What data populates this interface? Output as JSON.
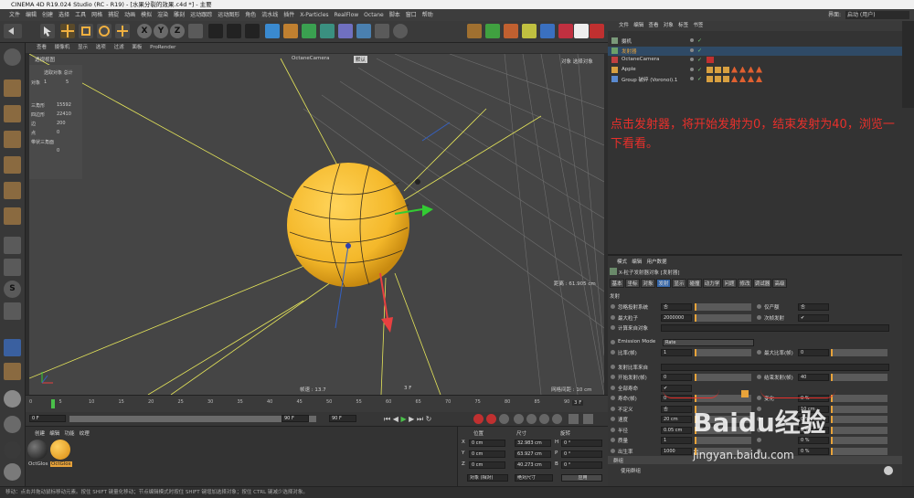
{
  "title": "CINEMA 4D R19.024 Studio (RC - R19) - [水果分裂的效果.c4d *] - 主要",
  "menu": [
    "文件",
    "编辑",
    "创建",
    "选择",
    "工具",
    "网格",
    "捕捉",
    "动画",
    "模拟",
    "渲染",
    "雕刻",
    "运动跟踪",
    "运动图形",
    "角色",
    "流水线",
    "插件",
    "X-Particles",
    "RealFlow",
    "Octane",
    "脚本",
    "窗口",
    "帮助"
  ],
  "layout_label": "界面:",
  "layout_value": "启动 (用户)",
  "viewport": {
    "menu": [
      "查看",
      "摄像机",
      "显示",
      "选项",
      "过滤",
      "面板",
      "ProRender"
    ],
    "title": "透视视图",
    "camera": "OctaneCamera",
    "camera_tag": "默认",
    "top_right": "对象 选择对象",
    "stats": {
      "header": "选取对象 总计",
      "obj_label": "对象",
      "obj_sel": "1",
      "obj_total": "5",
      "tri_label": "三角形",
      "tri": "15592",
      "poly_label": "四边形",
      "poly": "22410",
      "edge_label": "边",
      "edge": "200",
      "pt_label": "点",
      "pt": "0",
      "hidden_label": "带状三角面",
      "hidden": "0"
    },
    "dist": "距离 : 61.905 cm",
    "speed": "帧速 : 13.7",
    "frame": "3 F",
    "grid": "网格间距 : 10 cm"
  },
  "timeline": {
    "ticks": [
      "0",
      "5",
      "10",
      "15",
      "20",
      "25",
      "30",
      "35",
      "40",
      "45",
      "50",
      "55",
      "60",
      "65",
      "70",
      "75",
      "80",
      "85",
      "90"
    ],
    "current": "3 F"
  },
  "playbar": {
    "start": "0 F",
    "pos": "0 F",
    "end": "90 F",
    "end2": "90 F"
  },
  "materials": {
    "menu": [
      "创建",
      "编辑",
      "功能",
      "纹理"
    ],
    "items": [
      "OctGlos",
      "OctGlos"
    ]
  },
  "coords": {
    "headers": [
      "位置",
      "尺寸",
      "旋转"
    ],
    "rows": [
      {
        "axis": "X",
        "pos": "0 cm",
        "size": "32.983 cm",
        "rl": "H",
        "rot": "0 °"
      },
      {
        "axis": "Y",
        "pos": "0 cm",
        "size": "63.927 cm",
        "rl": "P",
        "rot": "0 °"
      },
      {
        "axis": "Z",
        "pos": "0 cm",
        "size": "40.273 cm",
        "rl": "B",
        "rot": "0 °"
      }
    ],
    "mode": "对象 (相对)",
    "size_mode": "绝对尺寸",
    "apply": "应用"
  },
  "objects": {
    "menu": [
      "文件",
      "编辑",
      "查看",
      "对象",
      "标签",
      "书签"
    ],
    "items": [
      "摄机",
      "发射器",
      "OctaneCamera",
      "Apple",
      "Group 破碎 (Voronoi).1"
    ]
  },
  "instruction": "点击发射器，将开始发射为0，结束发射为40，浏览一下看看。",
  "attrs": {
    "menu": [
      "模式",
      "编辑",
      "用户数据"
    ],
    "object_title": "X-粒子发射器对象 [发射器]",
    "tabs": [
      "基本",
      "坐标",
      "对象",
      "发射",
      "显示",
      "碰撞",
      "动力学",
      "问题",
      "修改",
      "调试器",
      "高级"
    ],
    "active_tab": "发射",
    "section": "发射",
    "rows": [
      {
        "l": "忽略投射系统",
        "v": "否",
        "l2": "仅产额",
        "v2": "否"
      },
      {
        "l": "最大粒子",
        "v": "2000000",
        "l2": "次帧发射",
        "v2": "✔"
      },
      {
        "l": "计算来自对象",
        "v": ""
      },
      {
        "l": "Emission Mode",
        "v": "Rate"
      },
      {
        "l": "比率(帧)",
        "v": "1",
        "l2": "最大比率(帧)",
        "v2": "0"
      },
      {
        "l": "发射比率来自",
        "v": ""
      },
      {
        "l": "开始发射(帧)",
        "v": "0",
        "l2": "结束发射(帧)",
        "v2": "40"
      },
      {
        "l": "全部寿命",
        "v": "✔"
      },
      {
        "l": "寿命(帧)",
        "v": "0",
        "l2": "变化",
        "v2": "0 %"
      },
      {
        "l": "不定义",
        "v": "否",
        "l2": "",
        "v2": "10 cm"
      },
      {
        "l": "速度",
        "v": "20 cm",
        "l2": "",
        "v2": "0 %"
      },
      {
        "l": "半径",
        "v": "0.05 cm",
        "l2": "",
        "v2": "0 %"
      },
      {
        "l": "质量",
        "v": "1",
        "l2": "",
        "v2": "0 %"
      },
      {
        "l": "出生率",
        "v": "1000",
        "l2": "",
        "v2": "0 %"
      }
    ],
    "group": "群组",
    "group_item": "使用群组"
  },
  "status": "移动：点击并拖动鼠标移动元素。按住 SHIFT 键量化移动；节点编辑模式时按住 SHIFT 键增加选择对象；按住 CTRL 键减少选择对象。",
  "watermark": "Baidu经验",
  "watermark_url": "jingyan.baidu.com",
  "colors": {
    "accent": "#e8a33a",
    "instruction": "#e8302b",
    "select": "#2f6fb0",
    "sphere": "#f4b82a",
    "guide": "#e6e65a",
    "green_axis": "#33cc33",
    "red_axis": "#e84040",
    "blue_axis": "#3560c0"
  }
}
